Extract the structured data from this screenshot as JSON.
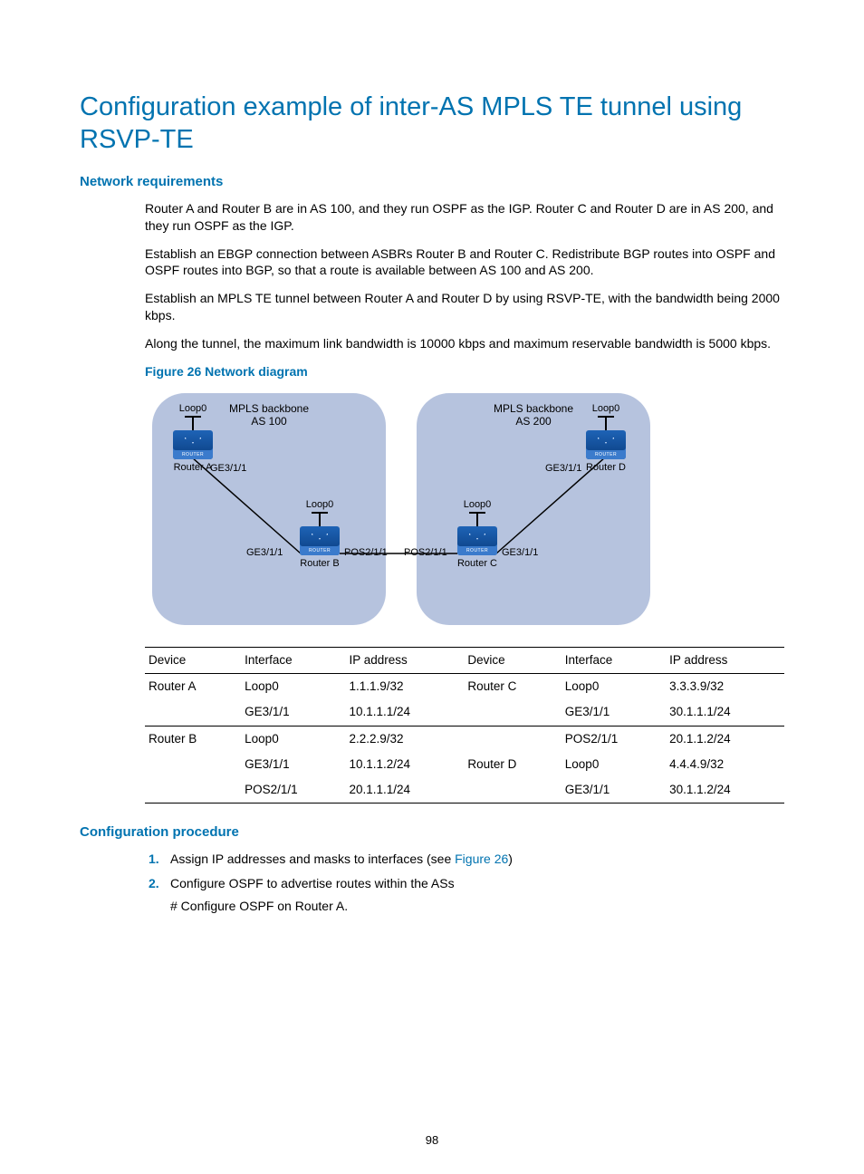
{
  "title": "Configuration example of inter-AS MPLS TE tunnel using RSVP-TE",
  "sec_req": "Network requirements",
  "paragraphs": {
    "p1": "Router A and Router B are in AS 100, and they run OSPF as the IGP. Router C and Router D are in AS 200, and they run OSPF as the IGP.",
    "p2": "Establish an EBGP connection between ASBRs Router B and Router C. Redistribute BGP routes into OSPF and OSPF routes into BGP, so that a route is available between AS 100 and AS 200.",
    "p3": "Establish an MPLS TE tunnel between Router A and Router D by using RSVP-TE, with the bandwidth being 2000 kbps.",
    "p4": "Along the tunnel, the maximum link bandwidth is 10000 kbps and maximum reservable bandwidth is 5000 kbps."
  },
  "fig_caption": "Figure 26 Network diagram",
  "diagram": {
    "cloud_left_l1": "MPLS backbone",
    "cloud_left_l2": "AS 100",
    "cloud_right_l1": "MPLS backbone",
    "cloud_right_l2": "AS 200",
    "loop0": "Loop0",
    "router_a": "Router A",
    "router_b": "Router B",
    "router_c": "Router C",
    "router_d": "Router D",
    "ge": "GE3/1/1",
    "pos": "POS2/1/1"
  },
  "table": {
    "headers": {
      "c1": "Device",
      "c2": "Interface",
      "c3": "IP address",
      "c4": "Device",
      "c5": "Interface",
      "c6": "IP address"
    },
    "rows": [
      {
        "c1": "Router A",
        "c2": "Loop0",
        "c3": "1.1.1.9/32",
        "c4": "Router C",
        "c5": "Loop0",
        "c6": "3.3.3.9/32"
      },
      {
        "c1": "",
        "c2": "GE3/1/1",
        "c3": "10.1.1.1/24",
        "c4": "",
        "c5": "GE3/1/1",
        "c6": "30.1.1.1/24"
      },
      {
        "c1": "Router B",
        "c2": "Loop0",
        "c3": "2.2.2.9/32",
        "c4": "",
        "c5": "POS2/1/1",
        "c6": "20.1.1.2/24"
      },
      {
        "c1": "",
        "c2": "GE3/1/1",
        "c3": "10.1.1.2/24",
        "c4": "Router D",
        "c5": "Loop0",
        "c6": "4.4.4.9/32"
      },
      {
        "c1": "",
        "c2": "POS2/1/1",
        "c3": "20.1.1.1/24",
        "c4": "",
        "c5": "GE3/1/1",
        "c6": "30.1.1.2/24"
      }
    ]
  },
  "sec_proc": "Configuration procedure",
  "steps": {
    "s1a": "Assign IP addresses and masks to interfaces (see ",
    "s1link": "Figure 26",
    "s1b": ")",
    "s2": "Configure OSPF to advertise routes within the ASs",
    "s2sub": "# Configure OSPF on Router A."
  },
  "pagenum": "98"
}
